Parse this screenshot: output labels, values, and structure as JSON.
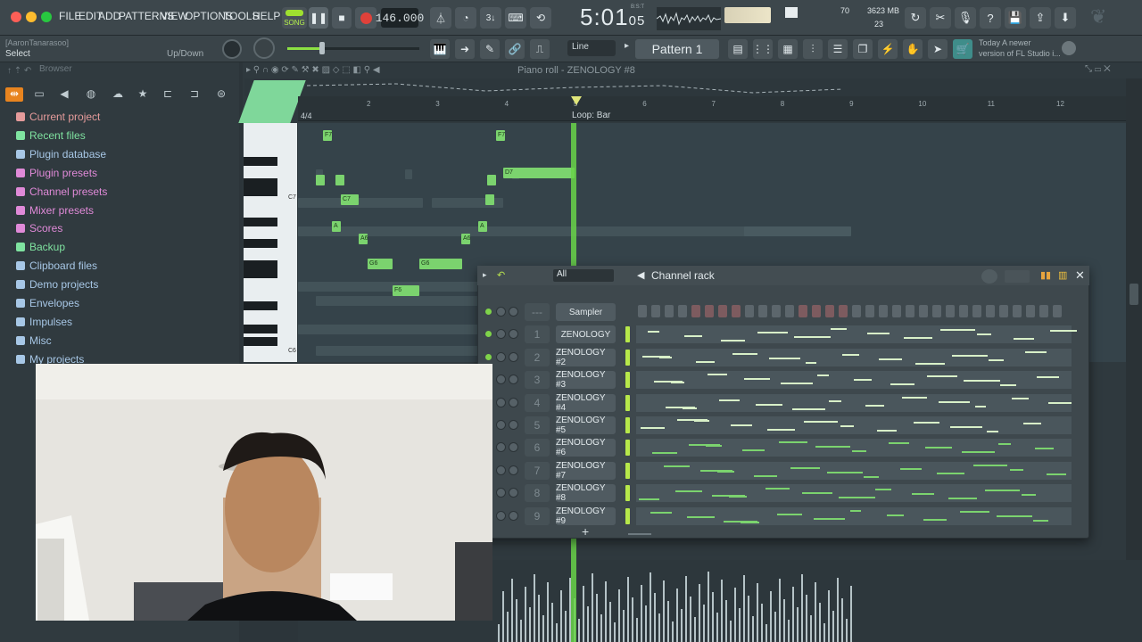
{
  "menubar": {
    "items": [
      "FILE",
      "EDIT",
      "ADD",
      "PATTERNS",
      "VIEW",
      "OPTIONS",
      "TOOLS",
      "HELP"
    ],
    "song_label": "SONG",
    "tempo": "146.000",
    "time_main": "5:01",
    "time_sub": "05",
    "time_small": "B:S:T",
    "cpu_value": "70",
    "ram_value": "3623 MB",
    "polyphony": "23"
  },
  "toolbar2": {
    "hint_user": "[AaronTanarasoo]",
    "hint_action": "Select",
    "updown_label": "Up/Down",
    "line_mode": "Line",
    "pattern_name": "Pattern 1",
    "news_line1": "Today  A newer",
    "news_line2": "version of FL Studio i..."
  },
  "browser": {
    "header": "Browser",
    "items": [
      {
        "label": "Current project",
        "color": "#e59b9b"
      },
      {
        "label": "Recent files",
        "color": "#7fe3a0"
      },
      {
        "label": "Plugin database",
        "color": "#a7c7e6"
      },
      {
        "label": "Plugin presets",
        "color": "#e08ad8"
      },
      {
        "label": "Channel presets",
        "color": "#e08ad8"
      },
      {
        "label": "Mixer presets",
        "color": "#e08ad8"
      },
      {
        "label": "Scores",
        "color": "#e08ad8"
      },
      {
        "label": "Backup",
        "color": "#7fe3a0"
      },
      {
        "label": "Clipboard files",
        "color": "#a7c7e6"
      },
      {
        "label": "Demo projects",
        "color": "#a7c7e6"
      },
      {
        "label": "Envelopes",
        "color": "#a7c7e6"
      },
      {
        "label": "Impulses",
        "color": "#a7c7e6"
      },
      {
        "label": "Misc",
        "color": "#a7c7e6"
      },
      {
        "label": "My projects",
        "color": "#a7c7e6"
      }
    ]
  },
  "pianoroll": {
    "title": "Piano roll - ZENOLOGY #8",
    "time_sig": "4/4",
    "loop_label": "Loop: Bar",
    "ruler_numbers": [
      "2",
      "3",
      "4",
      "5",
      "6",
      "7",
      "8",
      "9",
      "10",
      "11",
      "12"
    ],
    "key_labels": [
      "C7",
      "C6"
    ],
    "note_labels": [
      "F7",
      "F7",
      "D7",
      "C7",
      "A",
      "A6",
      "A",
      "A6",
      "G6",
      "G6",
      "F6"
    ]
  },
  "channel_rack": {
    "title": "Channel rack",
    "filter": "All",
    "channels": [
      {
        "num": "---",
        "name": "Sampler"
      },
      {
        "num": "1",
        "name": "ZENOLOGY"
      },
      {
        "num": "2",
        "name": "ZENOLOGY #2"
      },
      {
        "num": "3",
        "name": "ZENOLOGY #3"
      },
      {
        "num": "4",
        "name": "ZENOLOGY #4"
      },
      {
        "num": "5",
        "name": "ZENOLOGY #5"
      },
      {
        "num": "6",
        "name": "ZENOLOGY #6"
      },
      {
        "num": "7",
        "name": "ZENOLOGY #7"
      },
      {
        "num": "8",
        "name": "ZENOLOGY #8"
      },
      {
        "num": "9",
        "name": "ZENOLOGY #9"
      }
    ],
    "add_label": "+"
  },
  "colors": {
    "accent_green": "#7bd36e",
    "playhead": "#69d349",
    "record_red": "#e0413a",
    "song_lamp": "#9fe02f"
  }
}
